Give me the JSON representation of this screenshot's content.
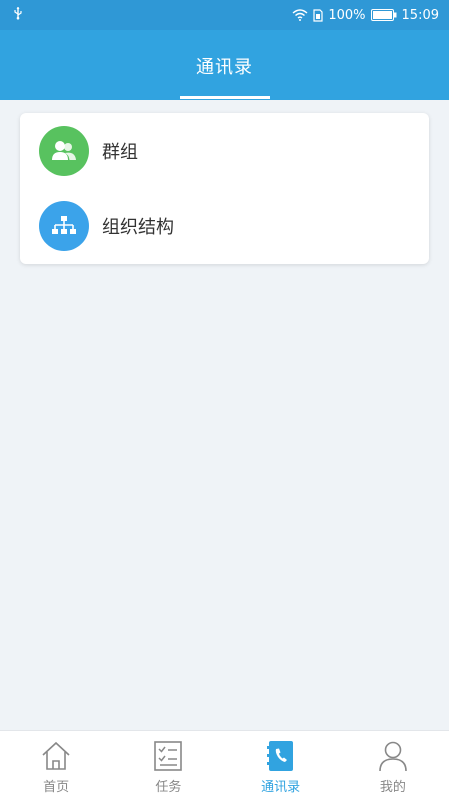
{
  "status_bar": {
    "battery": "100%",
    "time": "15:09"
  },
  "header": {
    "title": "通讯录"
  },
  "contacts": {
    "items": [
      {
        "label": "群组",
        "icon": "group-icon",
        "color": "#58c25f"
      },
      {
        "label": "组织结构",
        "icon": "org-structure-icon",
        "color": "#3ba3ea"
      }
    ]
  },
  "bottom_nav": {
    "items": [
      {
        "label": "首页",
        "icon": "home-icon",
        "active": false
      },
      {
        "label": "任务",
        "icon": "task-icon",
        "active": false
      },
      {
        "label": "通讯录",
        "icon": "contacts-icon",
        "active": true
      },
      {
        "label": "我的",
        "icon": "profile-icon",
        "active": false
      }
    ]
  },
  "colors": {
    "primary": "#31a3e0",
    "background": "#eff3f7"
  }
}
